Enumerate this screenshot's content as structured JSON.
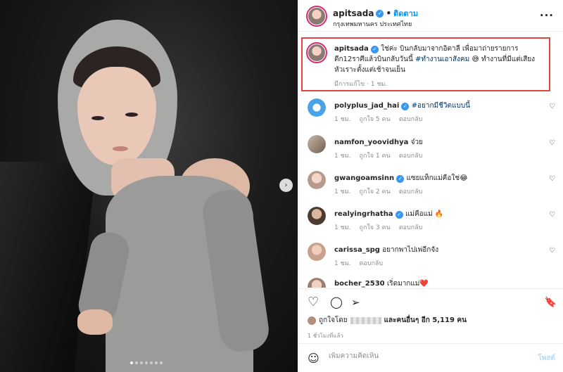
{
  "photo": {
    "next_glyph": "›",
    "carousel_count": 7,
    "carousel_active": 0
  },
  "header": {
    "username": "apitsada",
    "verified_glyph": "✓",
    "separator": "•",
    "follow_label": "ติดตาม",
    "location": "กรุงเทพมหานคร ประเทศไทย",
    "more_glyph": "···"
  },
  "caption": {
    "username": "apitsada",
    "text_1": "ใช่ค่ะ บินกลับมาจากอิตาลี เพื่อมาถ่ายรายการตีก12ราศีแล้วบินกลับวันนี้",
    "hashtag": "#ทำงานเอาสังคม",
    "emoji": "😅",
    "text_2": "ทำงานที่มีแต่เสียงหัวเราะตั้งแต่เช้าจนเย็น",
    "edited": "มีการแก้ไข · 1 ชม."
  },
  "comments": [
    {
      "username": "polyplus_jad_hai",
      "verified": true,
      "text": "#อยากมีชีวิตแบบนี้",
      "text_is_hashtag": true,
      "time": "1 ชม.",
      "likes": "ถูกใจ 5 คน",
      "reply": "ตอบกลับ"
    },
    {
      "username": "namfon_yoovidhya",
      "verified": false,
      "text": "จ๋วย",
      "text_is_hashtag": false,
      "time": "1 ชม.",
      "likes": "ถูกใจ 1 คน",
      "reply": "ตอบกลับ"
    },
    {
      "username": "gwangoamsinn",
      "verified": true,
      "text": "แซยแท็กแม่คือใช่😂",
      "text_is_hashtag": false,
      "time": "1 ชม.",
      "likes": "ถูกใจ 2 คน",
      "reply": "ตอบกลับ"
    },
    {
      "username": "realyingrhatha",
      "verified": true,
      "text": "แม่คือแม่ 🔥",
      "text_is_hashtag": false,
      "time": "1 ชม.",
      "likes": "ถูกใจ 3 คน",
      "reply": "ตอบกลับ"
    },
    {
      "username": "carissa_spg",
      "verified": false,
      "text": "อยากพาไปเพ่อีกจัง",
      "text_is_hashtag": false,
      "time": "1 ชม.",
      "likes": "",
      "reply": "ตอบกลับ"
    },
    {
      "username": "bocher_2530",
      "verified": false,
      "text": "เริ่ดมากแม่❤️",
      "text_is_hashtag": false,
      "time": "",
      "likes": "",
      "reply": ""
    }
  ],
  "heart_glyph": "♡",
  "actions": {
    "like_glyph": "♡",
    "comment_glyph": "◯",
    "share_glyph": "➢",
    "save_glyph": "🔖"
  },
  "likes": {
    "prefix": "ถูกใจโดย",
    "suffix": "และคนอื่นๆ อีก 5,119 คน"
  },
  "post_time": "1 ชั่วโมงที่แล้ว",
  "comment_box": {
    "smile_glyph": "☺",
    "placeholder": "เพิ่มความคิดเห็น",
    "post_label": "โพสต์"
  },
  "colors": {
    "accent": "#0095f6",
    "highlight_box": "#e0453e",
    "verified": "#3897f0"
  }
}
